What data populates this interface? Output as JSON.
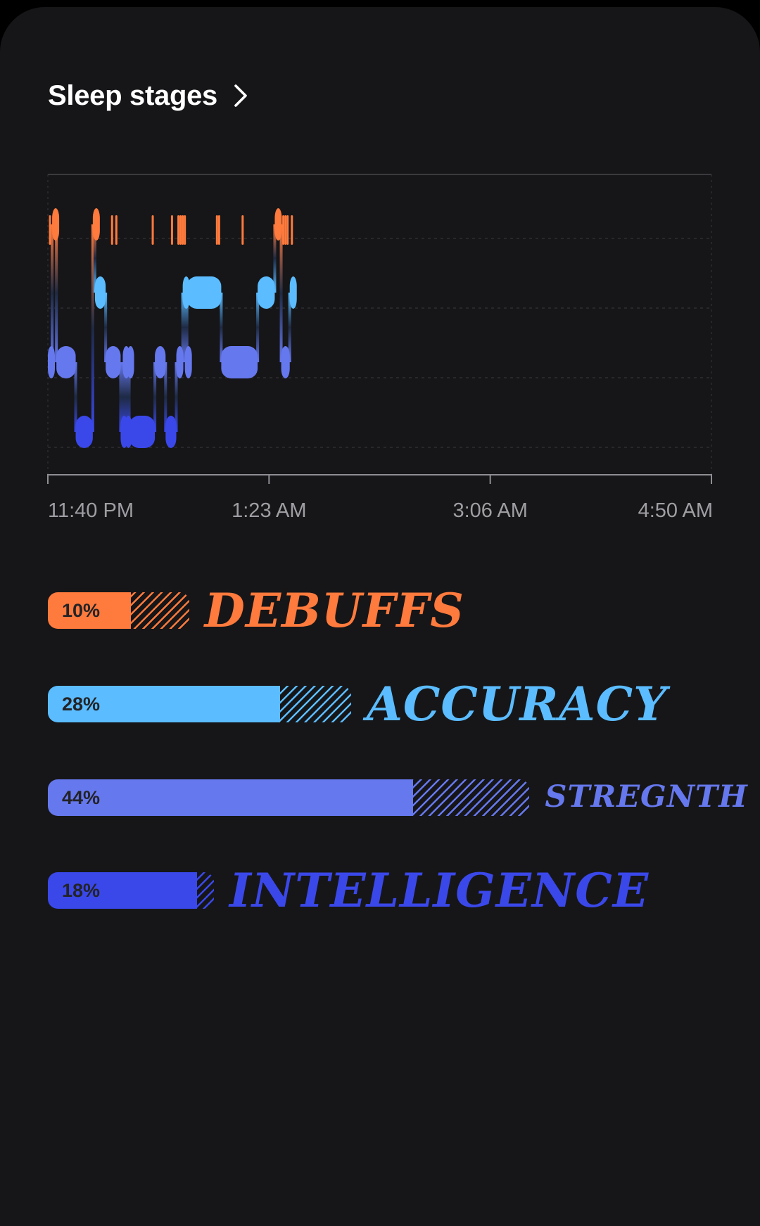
{
  "header": {
    "title": "Sleep stages",
    "chevron_icon": "chevron-right-icon"
  },
  "colors": {
    "background": "#161618",
    "awake": "#ff7a3d",
    "rem": "#5bbcff",
    "light": "#6678ee",
    "deep": "#3a48ea"
  },
  "chart_data": {
    "type": "hypnogram",
    "x_axis": {
      "start": "11:40 PM",
      "end": "4:50 AM",
      "start_minutes": 1420,
      "end_minutes": 1730,
      "tick_labels": [
        "11:40 PM",
        "1:23 AM",
        "3:06 AM",
        "4:50 AM"
      ]
    },
    "stage_order": [
      "awake",
      "rem",
      "light",
      "deep"
    ],
    "segments": [
      {
        "stage": "light",
        "start": "11:40 PM",
        "end": "11:42 PM"
      },
      {
        "stage": "awake",
        "start": "11:42 PM",
        "end": "11:44 PM"
      },
      {
        "stage": "light",
        "start": "11:44 PM",
        "end": "11:53 PM"
      },
      {
        "stage": "deep",
        "start": "11:53 PM",
        "end": "12:01 AM"
      },
      {
        "stage": "awake",
        "start": "12:01 AM",
        "end": "12:02 AM"
      },
      {
        "stage": "rem",
        "start": "12:02 AM",
        "end": "12:07 AM"
      },
      {
        "stage": "light",
        "start": "12:07 AM",
        "end": "12:14 AM"
      },
      {
        "stage": "deep",
        "start": "12:14 AM",
        "end": "12:15 AM"
      },
      {
        "stage": "light",
        "start": "12:15 AM",
        "end": "12:16 AM"
      },
      {
        "stage": "deep",
        "start": "12:16 AM",
        "end": "12:17 AM"
      },
      {
        "stage": "light",
        "start": "12:17 AM",
        "end": "12:18 AM"
      },
      {
        "stage": "deep",
        "start": "12:18 AM",
        "end": "12:30 AM"
      },
      {
        "stage": "light",
        "start": "12:30 AM",
        "end": "12:35 AM"
      },
      {
        "stage": "deep",
        "start": "12:35 AM",
        "end": "12:40 AM"
      },
      {
        "stage": "light",
        "start": "12:40 AM",
        "end": "12:43 AM"
      },
      {
        "stage": "rem",
        "start": "12:43 AM",
        "end": "12:44 AM"
      },
      {
        "stage": "light",
        "start": "12:44 AM",
        "end": "12:45 AM"
      },
      {
        "stage": "rem",
        "start": "12:45 AM",
        "end": "1:01 AM"
      },
      {
        "stage": "light",
        "start": "1:01 AM",
        "end": "1:18 AM"
      },
      {
        "stage": "rem",
        "start": "1:18 AM",
        "end": "1:26 AM"
      },
      {
        "stage": "awake",
        "start": "1:26 AM",
        "end": "1:29 AM"
      },
      {
        "stage": "light",
        "start": "1:29 AM",
        "end": "1:33 AM"
      },
      {
        "stage": "rem",
        "start": "1:33 AM",
        "end": "1:35 AM"
      }
    ],
    "brief_awakenings": [
      "11:41 PM",
      "12:10 AM",
      "12:12 AM",
      "12:29 AM",
      "12:38 AM",
      "12:41 AM",
      "12:42 AM",
      "12:43 AM",
      "12:44 AM",
      "12:59 AM",
      "1:00 AM",
      "1:11 AM",
      "1:30 AM",
      "1:31 AM",
      "1:32 AM",
      "1:34 AM"
    ]
  },
  "stages": [
    {
      "label": "DEBUFFS",
      "percent": "10%",
      "fill": 0.1,
      "hatch": 0.07
    },
    {
      "label": "ACCURACY",
      "percent": "28%",
      "fill": 0.28,
      "hatch": 0.085
    },
    {
      "label": "STREGNTH",
      "percent": "44%",
      "fill": 0.44,
      "hatch": 0.14
    },
    {
      "label": "INTELLIGENCE",
      "percent": "18%",
      "fill": 0.18,
      "hatch": 0.02
    }
  ]
}
